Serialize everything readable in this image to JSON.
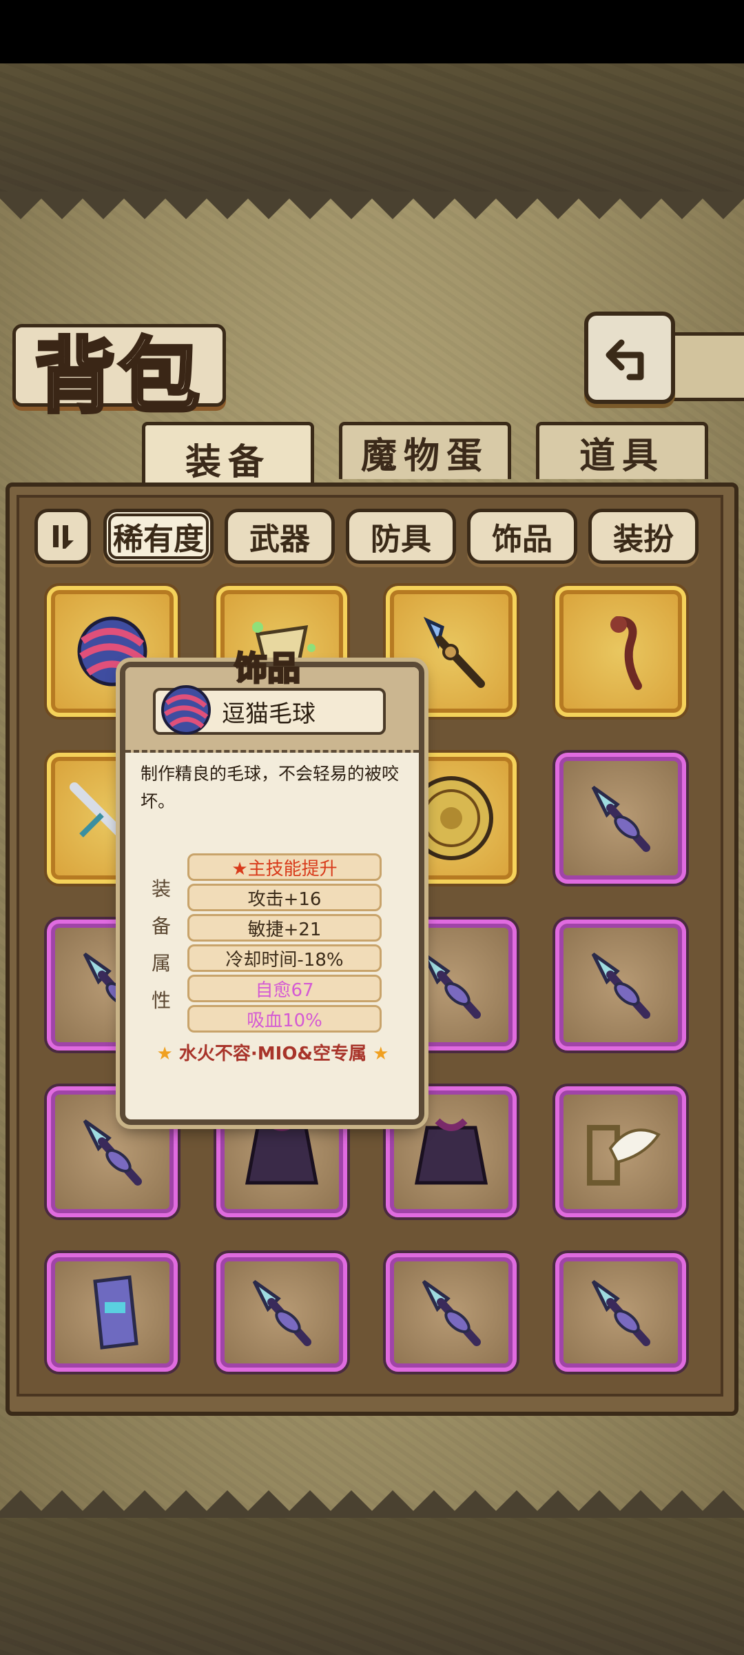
{
  "title": "背包",
  "tabs": [
    {
      "label": "装备",
      "active": true
    },
    {
      "label": "魔物蛋",
      "active": false
    },
    {
      "label": "道具",
      "active": false
    }
  ],
  "filters": [
    {
      "label": "稀有度",
      "active": true
    },
    {
      "label": "武器",
      "active": false
    },
    {
      "label": "防具",
      "active": false
    },
    {
      "label": "饰品",
      "active": false
    },
    {
      "label": "装扮",
      "active": false
    }
  ],
  "items": [
    {
      "icon": "yarn-ball-icon",
      "rarity": "gold"
    },
    {
      "icon": "necklace-icon",
      "rarity": "gold"
    },
    {
      "icon": "spear-icon",
      "rarity": "gold"
    },
    {
      "icon": "staff-icon",
      "rarity": "gold"
    },
    {
      "icon": "sword-icon",
      "rarity": "gold"
    },
    {
      "icon": "hidden-slot",
      "rarity": "gold"
    },
    {
      "icon": "golden-disc-icon",
      "rarity": "gold"
    },
    {
      "icon": "drill-lance-icon",
      "rarity": "purple"
    },
    {
      "icon": "drill-lance-icon",
      "rarity": "purple"
    },
    {
      "icon": "hidden-slot",
      "rarity": "purple"
    },
    {
      "icon": "drill-lance-icon",
      "rarity": "purple"
    },
    {
      "icon": "drill-lance-icon",
      "rarity": "purple"
    },
    {
      "icon": "drill-lance-icon",
      "rarity": "purple"
    },
    {
      "icon": "cloak-icon",
      "rarity": "purple"
    },
    {
      "icon": "cloak-icon",
      "rarity": "purple"
    },
    {
      "icon": "dove-harp-icon",
      "rarity": "purple"
    },
    {
      "icon": "bracer-icon",
      "rarity": "purple"
    },
    {
      "icon": "drill-lance-icon",
      "rarity": "purple"
    },
    {
      "icon": "drill-lance-icon",
      "rarity": "purple"
    },
    {
      "icon": "drill-lance-icon",
      "rarity": "purple"
    }
  ],
  "popup": {
    "category": "饰品",
    "item_name": "逗猫毛球",
    "description": "制作精良的毛球，不会轻易的被咬坏。",
    "attr_label": [
      "装",
      "备",
      "属",
      "性"
    ],
    "attributes": [
      {
        "text": "★主技能提升",
        "color": "#d83a1a"
      },
      {
        "text": "攻击+16",
        "color": "#3a2a18"
      },
      {
        "text": "敏捷+21",
        "color": "#3a2a18"
      },
      {
        "text": "冷却时间-18%",
        "color": "#3a2a18"
      },
      {
        "text": "自愈67",
        "color": "#d45ad4"
      },
      {
        "text": "吸血10%",
        "color": "#d45ad4"
      }
    ],
    "exclusive": "水火不容·MIO&空专属"
  }
}
